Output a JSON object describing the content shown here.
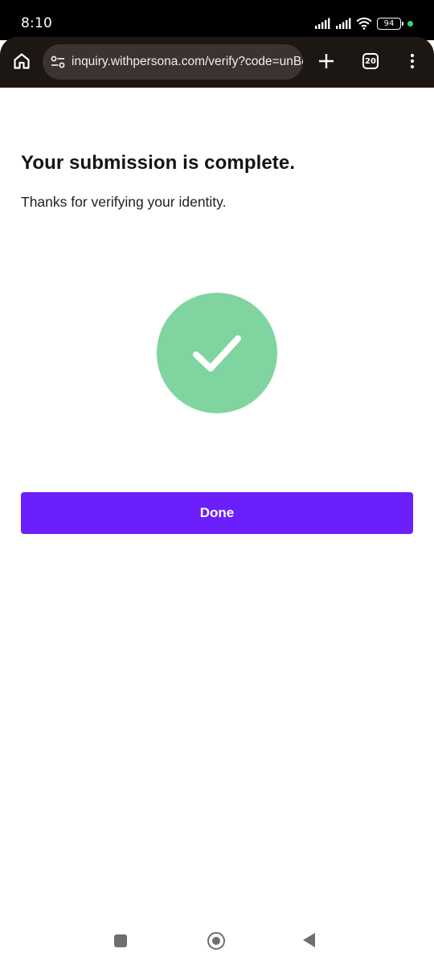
{
  "status_bar": {
    "time": "8:10",
    "battery": "94"
  },
  "browser": {
    "url": "inquiry.withpersona.com/verify?code=unBc",
    "tab_count": "20"
  },
  "page": {
    "title": "Your submission is complete.",
    "subtitle": "Thanks for verifying your identity.",
    "done_label": "Done"
  },
  "colors": {
    "accent": "#6a1ffb",
    "success": "#7fd49f"
  },
  "icons": [
    "home-icon",
    "tune-icon",
    "plus-icon",
    "tabs-icon",
    "more-vert-icon",
    "check-icon"
  ]
}
